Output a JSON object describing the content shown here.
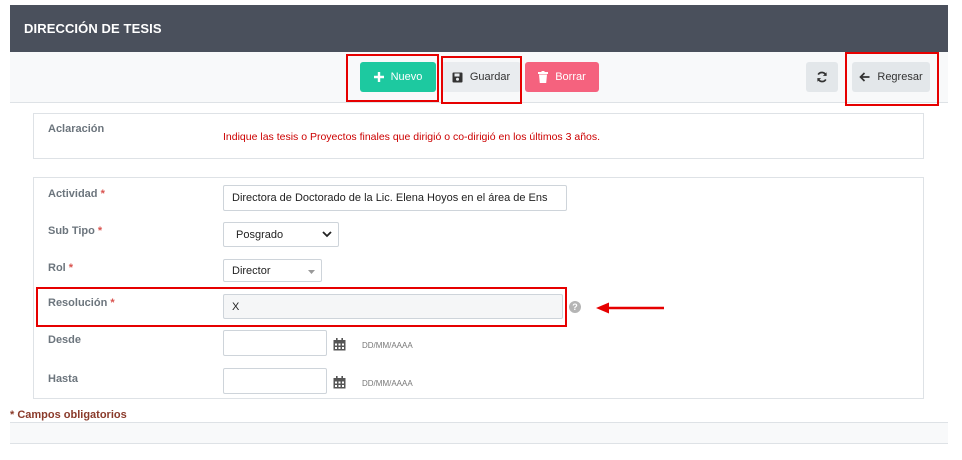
{
  "header": {
    "title": "DIRECCIÓN DE TESIS"
  },
  "toolbar": {
    "new_label": "Nuevo",
    "save_label": "Guardar",
    "delete_label": "Borrar",
    "back_label": "Regresar"
  },
  "notice": {
    "label": "Aclaración",
    "text": "Indique las tesis o Proyectos finales que dirigió o co-dirigió en los últimos 3 años."
  },
  "form": {
    "actividad": {
      "label": "Actividad",
      "value": "Directora de Doctorado de la Lic. Elena Hoyos en el área de Ens"
    },
    "subtipo": {
      "label": "Sub Tipo",
      "value": "Posgrado"
    },
    "rol": {
      "label": "Rol",
      "value": "Director"
    },
    "resolucion": {
      "label": "Resolución",
      "value": "X",
      "help": "?"
    },
    "desde": {
      "label": "Desde",
      "value": "",
      "format": "DD/MM/AAAA"
    },
    "hasta": {
      "label": "Hasta",
      "value": "",
      "format": "DD/MM/AAAA"
    },
    "required_mark": "*"
  },
  "footer": {
    "required_note": "* Campos obligatorios"
  },
  "colors": {
    "header": "#4a505c",
    "new": "#1dc9a0",
    "delete": "#f5627e",
    "notice": "#cc0000",
    "highlight": "#e60000"
  }
}
